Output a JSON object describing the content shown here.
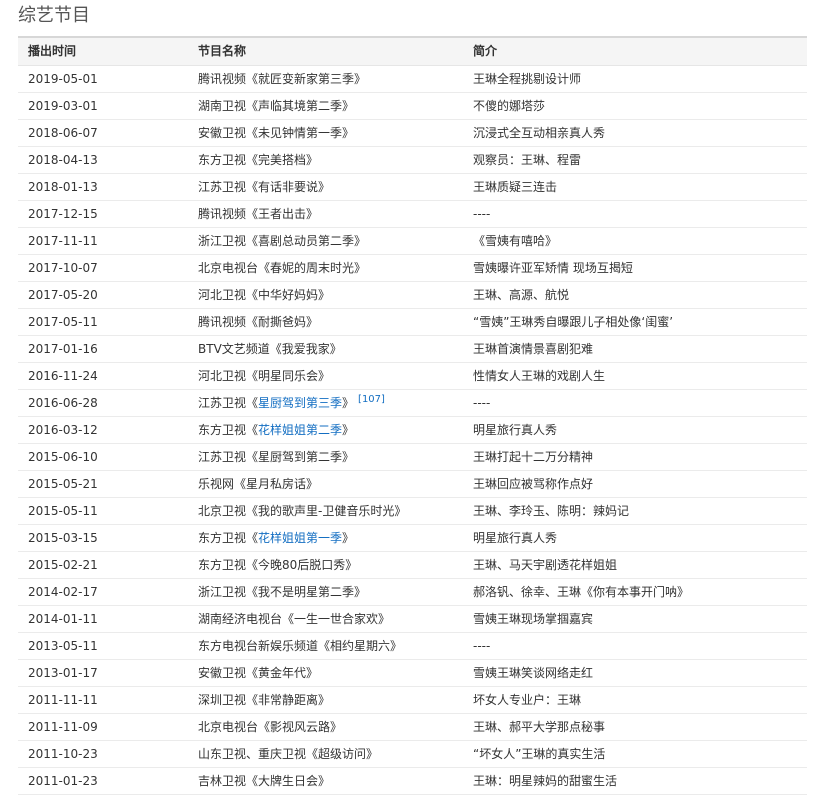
{
  "title": "综艺节目",
  "headers": [
    "播出时间",
    "节目名称",
    "简介"
  ],
  "rows": [
    {
      "date": "2019-05-01",
      "prefix": "腾讯视频《就匠变新家第三季》",
      "desc": "王琳全程挑剔设计师"
    },
    {
      "date": "2019-03-01",
      "prefix": "湖南卫视《声临其境第二季》",
      "desc": "不傻的娜塔莎"
    },
    {
      "date": "2018-06-07",
      "prefix": "安徽卫视《未见钟情第一季》",
      "desc": "沉浸式全互动相亲真人秀"
    },
    {
      "date": "2018-04-13",
      "prefix": "东方卫视《完美搭档》",
      "desc": "观察员：王琳、程雷"
    },
    {
      "date": "2018-01-13",
      "prefix": "江苏卫视《有话非要说》",
      "desc": "王琳质疑三连击"
    },
    {
      "date": "2017-12-15",
      "prefix": "腾讯视频《王者出击》",
      "desc": "----"
    },
    {
      "date": "2017-11-11",
      "prefix": "浙江卫视《喜剧总动员第二季》",
      "desc": "《雪姨有嘻哈》"
    },
    {
      "date": "2017-10-07",
      "prefix": "北京电视台《春妮的周末时光》",
      "desc": "雪姨曝许亚军矫情 现场互揭短"
    },
    {
      "date": "2017-05-20",
      "prefix": "河北卫视《中华好妈妈》",
      "desc": "王琳、高源、航悦"
    },
    {
      "date": "2017-05-11",
      "prefix": "腾讯视频《耐撕爸妈》",
      "desc": "“雪姨”王琳秀自曝跟儿子相处像‘闺蜜’"
    },
    {
      "date": "2017-01-16",
      "prefix": "BTV文艺频道《我爱我家》",
      "desc": "王琳首演情景喜剧犯难"
    },
    {
      "date": "2016-11-24",
      "prefix": "河北卫视《明星同乐会》",
      "desc": "性情女人王琳的戏剧人生"
    },
    {
      "date": "2016-06-28",
      "prefix": "江苏卫视《",
      "link": "星厨驾到第三季",
      "suffix": "》",
      "ref": "[107]",
      "desc": "----"
    },
    {
      "date": "2016-03-12",
      "prefix": "东方卫视《",
      "link": "花样姐姐第二季",
      "suffix": "》",
      "desc": "明星旅行真人秀"
    },
    {
      "date": "2015-06-10",
      "prefix": "江苏卫视《星厨驾到第二季》",
      "desc": "王琳打起十二万分精神"
    },
    {
      "date": "2015-05-21",
      "prefix": "乐视网《星月私房话》",
      "desc": "王琳回应被骂称作点好"
    },
    {
      "date": "2015-05-11",
      "prefix": "北京卫视《我的歌声里-卫健音乐时光》",
      "desc": "王琳、李玲玉、陈明：辣妈记"
    },
    {
      "date": "2015-03-15",
      "prefix": "东方卫视《",
      "link": "花样姐姐第一季",
      "suffix": "》",
      "desc": "明星旅行真人秀"
    },
    {
      "date": "2015-02-21",
      "prefix": "东方卫视《今晚80后脱口秀》",
      "desc": "王琳、马天宇剧透花样姐姐"
    },
    {
      "date": "2014-02-17",
      "prefix": "浙江卫视《我不是明星第二季》",
      "desc": "郝洛钒、徐幸、王琳《你有本事开门呐》"
    },
    {
      "date": "2014-01-11",
      "prefix": "湖南经济电视台《一生一世合家欢》",
      "desc": "雪姨王琳现场掌掴嘉宾"
    },
    {
      "date": "2013-05-11",
      "prefix": "东方电视台新娱乐频道《相约星期六》",
      "desc": "----"
    },
    {
      "date": "2013-01-17",
      "prefix": "安徽卫视《黄金年代》",
      "desc": "雪姨王琳笑谈网络走红"
    },
    {
      "date": "2011-11-11",
      "prefix": "深圳卫视《非常静距离》",
      "desc": "坏女人专业户：王琳"
    },
    {
      "date": "2011-11-09",
      "prefix": "北京电视台《影视风云路》",
      "desc": "王琳、郝平大学那点秘事"
    },
    {
      "date": "2011-10-23",
      "prefix": "山东卫视、重庆卫视《超级访问》",
      "desc": "“坏女人”王琳的真实生活"
    },
    {
      "date": "2011-01-23",
      "prefix": "吉林卫视《大牌生日会》",
      "desc": "王琳：明星辣妈的甜蜜生活"
    }
  ]
}
